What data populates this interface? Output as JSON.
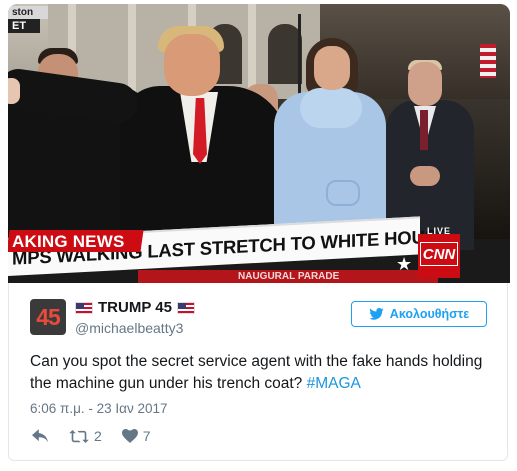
{
  "tv": {
    "chyron_top": "AKING NEWS",
    "chyron_main": "MPS WALKING LAST STRETCH TO WHITE HOUSE",
    "chyron_bottom": "NAUGURAL PARADE",
    "live": "LIVE",
    "logo": "CNN",
    "corner_top": "ston",
    "corner_bottom": "ET"
  },
  "tweet": {
    "avatar_text": "45",
    "display_name": "TRUMP 45",
    "handle": "@michaelbeatty3",
    "follow_label": "Ακολουθήστε",
    "text_main": "Can you spot the secret service agent with the fake hands holding the machine gun under his trench coat? ",
    "hashtag": "#MAGA",
    "timestamp": "6:06 π.μ. - 23 Ιαν 2017",
    "retweet_count": "2",
    "like_count": "7"
  },
  "colors": {
    "accent": "#1da1f2",
    "cnn_red": "#cc0b12",
    "text": "#14171a",
    "muted": "#657786"
  },
  "icons": [
    "flag-us-icon",
    "twitter-bird-icon",
    "reply-icon",
    "retweet-icon",
    "heart-icon"
  ]
}
